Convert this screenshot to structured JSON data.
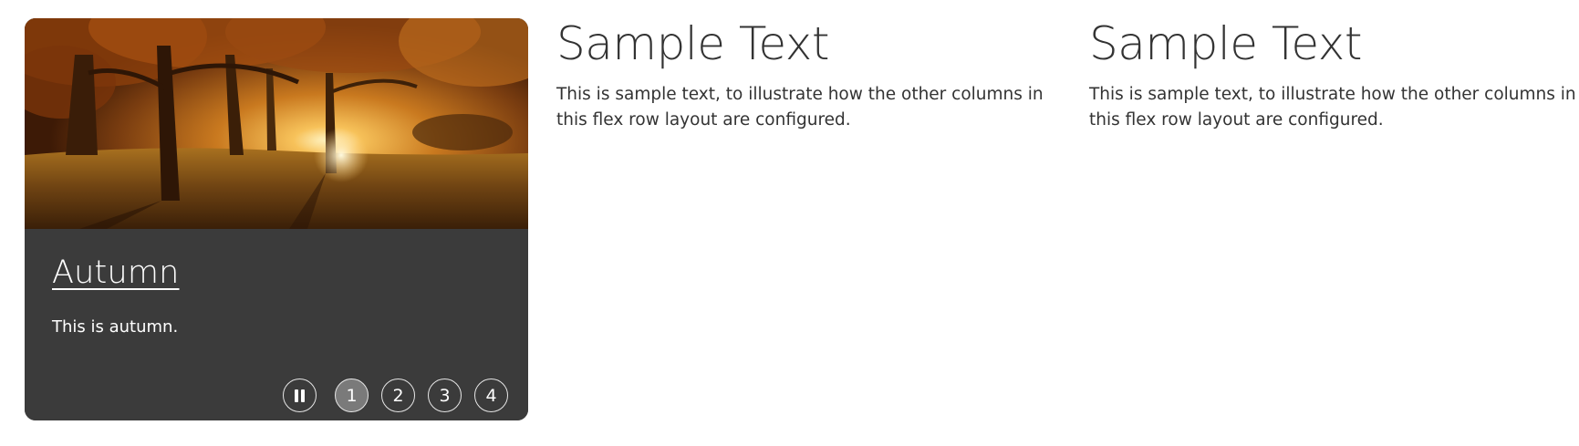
{
  "carousel": {
    "slide": {
      "title": "Autumn",
      "description": "This is autumn.",
      "image_icon": "autumn-trees-image"
    },
    "controls": {
      "pause_icon": "pause-icon",
      "pages": [
        "1",
        "2",
        "3",
        "4"
      ],
      "active_page": "1"
    }
  },
  "columns": [
    {
      "heading": "Sample Text",
      "body": "This is sample text, to illustrate how the other columns in this flex row layout are configured."
    },
    {
      "heading": "Sample Text",
      "body": "This is sample text, to illustrate how the other columns in this flex row layout are configured."
    }
  ],
  "colors": {
    "caption_background": "#3b3b3b",
    "text": "#333333",
    "active_page_fill": "#7a7a7a"
  }
}
